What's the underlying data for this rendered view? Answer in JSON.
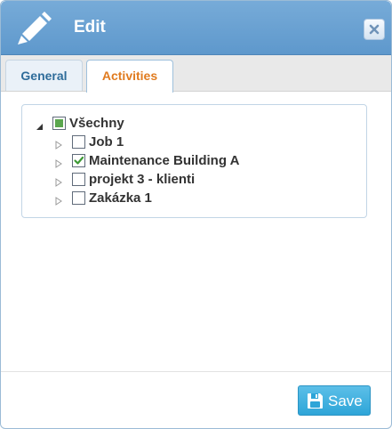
{
  "dialog": {
    "title": "Edit",
    "title_icon": "pencil-icon",
    "close_icon": "close-icon"
  },
  "tabs": [
    {
      "label": "General",
      "active": false
    },
    {
      "label": "Activities",
      "active": true
    }
  ],
  "tree": {
    "root": {
      "label": "Všechny",
      "expanded": true,
      "check_state": "partial"
    },
    "children": [
      {
        "label": "Job 1",
        "checked": false
      },
      {
        "label": "Maintenance Building A",
        "checked": true
      },
      {
        "label": "projekt 3 - klienti",
        "checked": false
      },
      {
        "label": "Zakázka 1",
        "checked": false
      }
    ]
  },
  "footer": {
    "save_label": "Save",
    "save_icon": "floppy-disk-icon"
  },
  "colors": {
    "titlebar": "#6aa3d5",
    "active_tab_text": "#e07b1f",
    "inactive_tab_text": "#2e6c9a",
    "check_green": "#5aa64e",
    "save_button": "#3ab0df"
  }
}
